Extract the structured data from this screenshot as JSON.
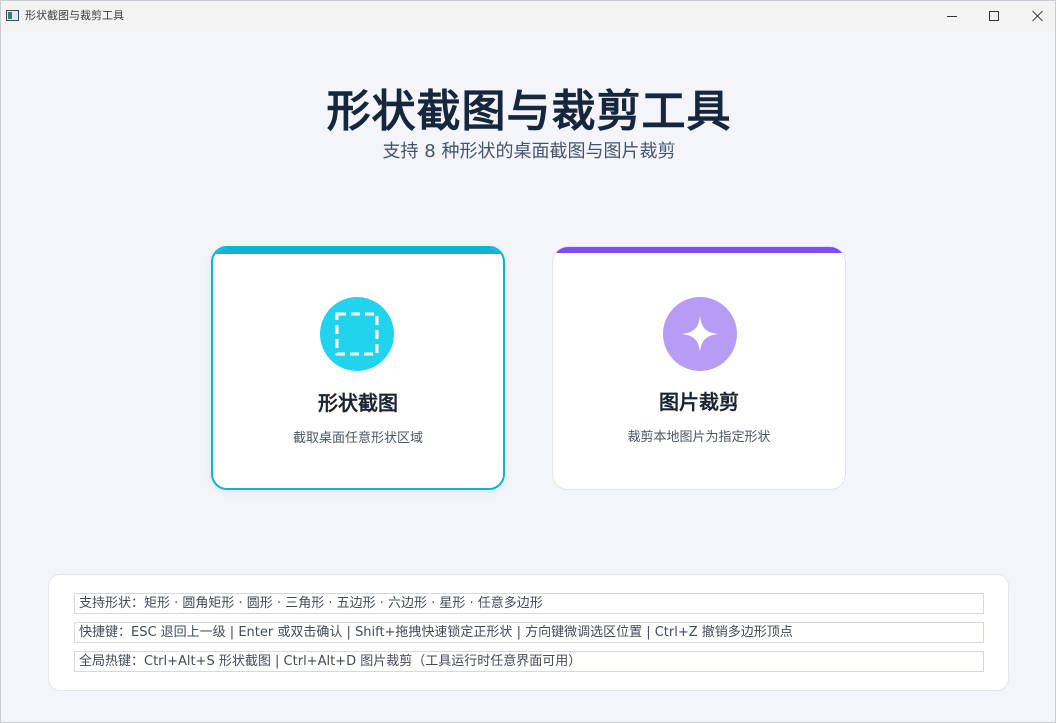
{
  "window": {
    "title": "形状截图与裁剪工具",
    "controls": [
      "minimize",
      "maximize",
      "close"
    ]
  },
  "header": {
    "title": "形状截图与裁剪工具",
    "subtitle": "支持 8 种形状的桌面截图与图片裁剪"
  },
  "cards": [
    {
      "title": "形状截图",
      "description": "截取桌面任意形状区域",
      "icon": "dashed-selection-icon",
      "accent": "#0fb4d1",
      "icon_bg": "#22d3ee",
      "selected": true
    },
    {
      "title": "图片裁剪",
      "description": "裁剪本地图片为指定形状",
      "icon": "sparkle-icon",
      "accent": "#7c4dff",
      "icon_bg": "#b79cf5",
      "selected": false
    }
  ],
  "info": {
    "shapes": "支持形状：矩形 · 圆角矩形 · 圆形 · 三角形 · 五边形 · 六边形 · 星形 · 任意多边形",
    "shortcuts": "快捷键：ESC 退回上一级 | Enter 或双击确认 | Shift+拖拽快速锁定正形状 | 方向键微调选区位置 | Ctrl+Z 撤销多边形顶点",
    "hotkeys": "全局热键：Ctrl+Alt+S 形状截图 | Ctrl+Alt+D 图片裁剪（工具运行时任意界面可用）"
  }
}
